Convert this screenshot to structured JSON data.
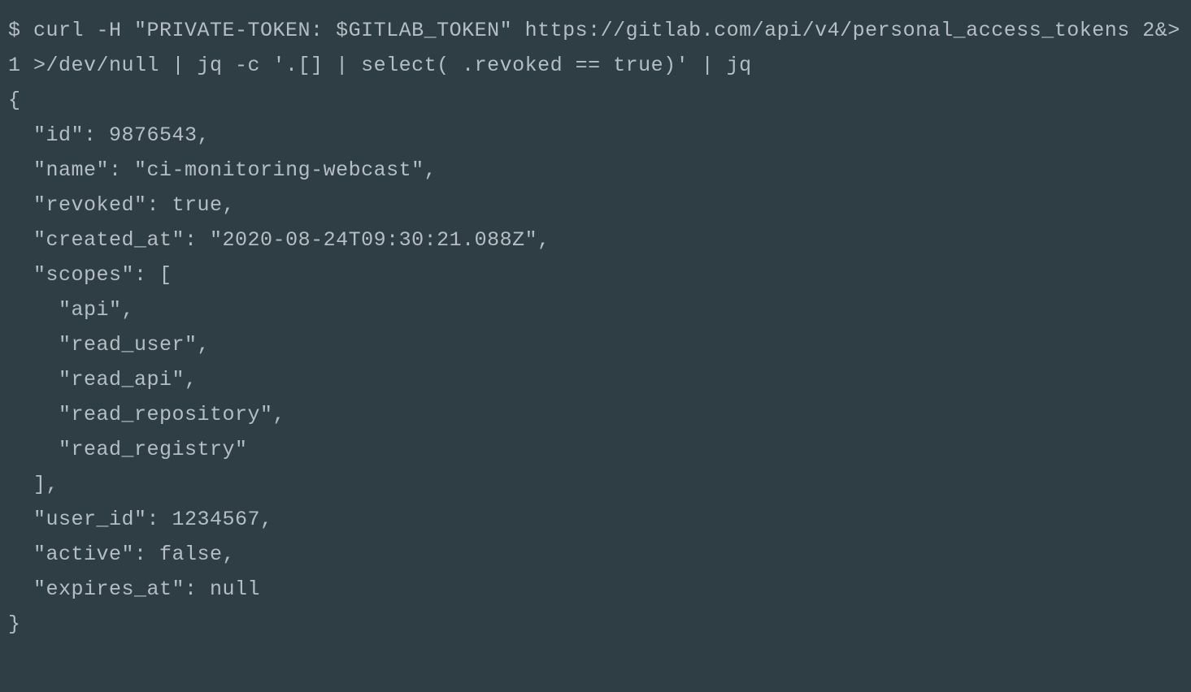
{
  "terminal": {
    "command": "$ curl -H \"PRIVATE-TOKEN: $GITLAB_TOKEN\" https://gitlab.com/api/v4/personal_access_tokens 2&>1 >/dev/null | jq -c '.[] | select( .revoked == true)' | jq",
    "output": "{\n  \"id\": 9876543,\n  \"name\": \"ci-monitoring-webcast\",\n  \"revoked\": true,\n  \"created_at\": \"2020-08-24T09:30:21.088Z\",\n  \"scopes\": [\n    \"api\",\n    \"read_user\",\n    \"read_api\",\n    \"read_repository\",\n    \"read_registry\"\n  ],\n  \"user_id\": 1234567,\n  \"active\": false,\n  \"expires_at\": null\n}"
  },
  "colors": {
    "background": "#2f3d45",
    "text": "#b4bec4"
  }
}
